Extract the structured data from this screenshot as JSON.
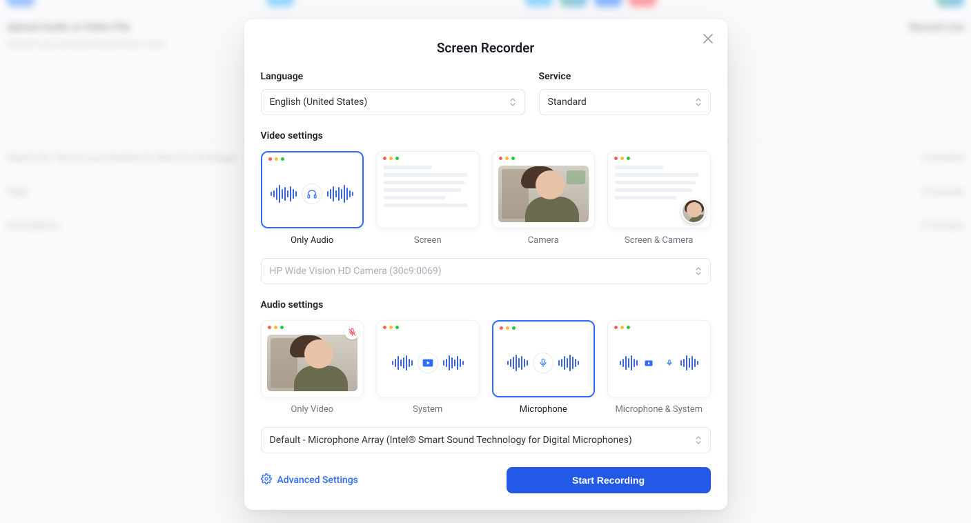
{
  "modal": {
    "title": "Screen Recorder",
    "language_label": "Language",
    "language_value": "English (United States)",
    "service_label": "Service",
    "service_value": "Standard",
    "video_section": "Video settings",
    "video_options": {
      "only_audio": "Only Audio",
      "screen": "Screen",
      "camera": "Camera",
      "screen_camera": "Screen & Camera"
    },
    "camera_select": "HP Wide Vision HD Camera (30c9:0069)",
    "audio_section": "Audio settings",
    "audio_options": {
      "only_video": "Only Video",
      "system": "System",
      "microphone": "Microphone",
      "mic_system": "Microphone & System"
    },
    "mic_select": "Default - Microphone Array (Intel® Smart Sound Technology for Digital Microphones)",
    "advanced": "Advanced Settings",
    "start": "Start Recording"
  },
  "background": {
    "card1_title": "Upload Audio or Video File",
    "card1_sub": "Convert any recorded media files to text",
    "card2_title": "Record Live",
    "list1_left": "Search for \"how to use timeline for Next Fix Prototype\"",
    "list1_right": "4 minutes",
    "list2_left": "Tags",
    "list2_right": "3 minutes",
    "list3_left": "Annotations",
    "list3_right": "2 minutes"
  }
}
